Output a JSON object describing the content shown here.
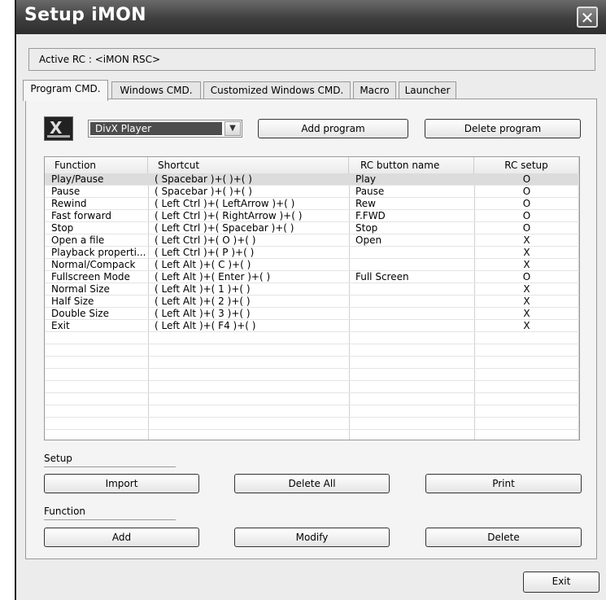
{
  "window": {
    "title": "Setup iMON",
    "close_glyph": "✕"
  },
  "active_rc": {
    "label": "Active RC : <iMON RSC>"
  },
  "tabs": [
    {
      "label": "Program CMD.",
      "active": true
    },
    {
      "label": "Windows CMD.",
      "active": false
    },
    {
      "label": "Customized Windows CMD.",
      "active": false
    },
    {
      "label": "Macro",
      "active": false
    },
    {
      "label": "Launcher",
      "active": false
    }
  ],
  "program": {
    "icon": "divx-program-icon",
    "selected": "DivX Player",
    "add_label": "Add program",
    "delete_label": "Delete program"
  },
  "table": {
    "columns": [
      "Function",
      "Shortcut",
      "RC button name",
      "RC setup"
    ],
    "rows": [
      [
        "Play/Pause",
        "( Spacebar )+( )+( )",
        "Play",
        "O"
      ],
      [
        "Pause",
        "( Spacebar )+( )+( )",
        "Pause",
        "O"
      ],
      [
        "Rewind",
        "( Left Ctrl )+( LeftArrow )+( )",
        "Rew",
        "O"
      ],
      [
        "Fast forward",
        "( Left Ctrl )+( RightArrow )+( )",
        "F.FWD",
        "O"
      ],
      [
        "Stop",
        "( Left Ctrl )+( Spacebar )+( )",
        "Stop",
        "O"
      ],
      [
        "Open a file",
        "( Left Ctrl )+( O )+( )",
        "Open",
        "X"
      ],
      [
        "Playback properti...",
        "( Left Ctrl )+( P )+( )",
        "",
        "X"
      ],
      [
        "Normal/Compack",
        "( Left Alt )+( C )+( )",
        "",
        "X"
      ],
      [
        "Fullscreen Mode",
        "( Left Alt )+( Enter )+( )",
        "Full Screen",
        "O"
      ],
      [
        "Normal Size",
        "( Left Alt )+( 1 )+( )",
        "",
        "X"
      ],
      [
        "Half Size",
        "( Left Alt )+( 2 )+( )",
        "",
        "X"
      ],
      [
        "Double Size",
        "( Left Alt )+( 3 )+( )",
        "",
        "X"
      ],
      [
        "Exit",
        "( Left Alt )+( F4 )+( )",
        "",
        "X"
      ]
    ]
  },
  "setup": {
    "label": "Setup",
    "import": "Import",
    "delete_all": "Delete All",
    "print": "Print"
  },
  "function": {
    "label": "Function",
    "add": "Add",
    "modify": "Modify",
    "delete": "Delete"
  },
  "exit_label": "Exit"
}
